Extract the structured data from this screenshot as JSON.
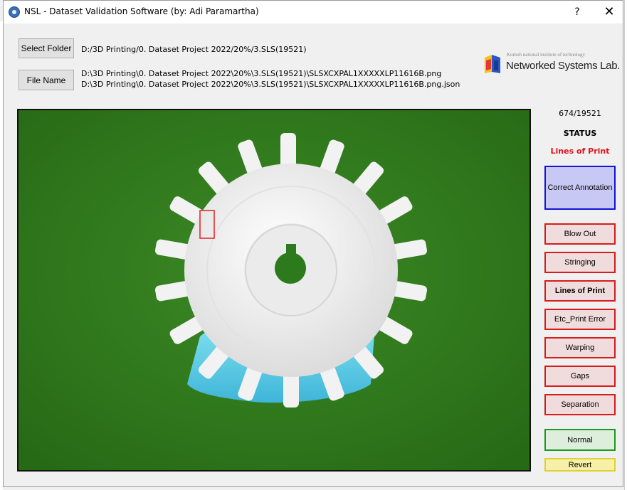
{
  "window": {
    "title": "NSL - Dataset Validation Software (by: Adi Paramartha)",
    "help_glyph": "?",
    "close_glyph": "✕"
  },
  "toolbar": {
    "select_folder_label": "Select Folder",
    "file_name_label": "File Name",
    "folder_path": "D:/3D Printing/0. Dataset Project 2022/20%/3.SLS(19521)",
    "image_path": "D:\\3D Printing\\0. Dataset Project 2022\\20%\\3.SLS(19521)\\SLSXCXPAL1XXXXXLP11616B.png",
    "json_path": "D:\\3D Printing\\0. Dataset Project 2022\\20%\\3.SLS(19521)\\SLSXCXPAL1XXXXXLP11616B.png.json"
  },
  "logo": {
    "small_text": "Kumoh national institute of technology",
    "name": "Networked Systems Lab.",
    "icon": "nsl-logo-icon",
    "colors": {
      "red": "#e43a2a",
      "blue": "#2a56c8",
      "yellow": "#f2c21a"
    }
  },
  "image_view": {
    "subject": "white 3D-printed gear on blue support, green background",
    "annotation_box_color": "#e02020",
    "background_color": "#2f7a1c"
  },
  "status": {
    "counter": "674/19521",
    "title": "STATUS",
    "value": "Lines of Print",
    "value_color": "#e0101a"
  },
  "actions": {
    "correct_annotation": "Correct Annotation",
    "errors": [
      {
        "label": "Blow Out",
        "active": false
      },
      {
        "label": "Stringing",
        "active": false
      },
      {
        "label": "Lines of Print",
        "active": true
      },
      {
        "label": "Etc_Print Error",
        "active": false
      },
      {
        "label": "Warping",
        "active": false
      },
      {
        "label": "Gaps",
        "active": false
      },
      {
        "label": "Separation",
        "active": false
      }
    ],
    "normal": "Normal",
    "revert": "Revert"
  }
}
